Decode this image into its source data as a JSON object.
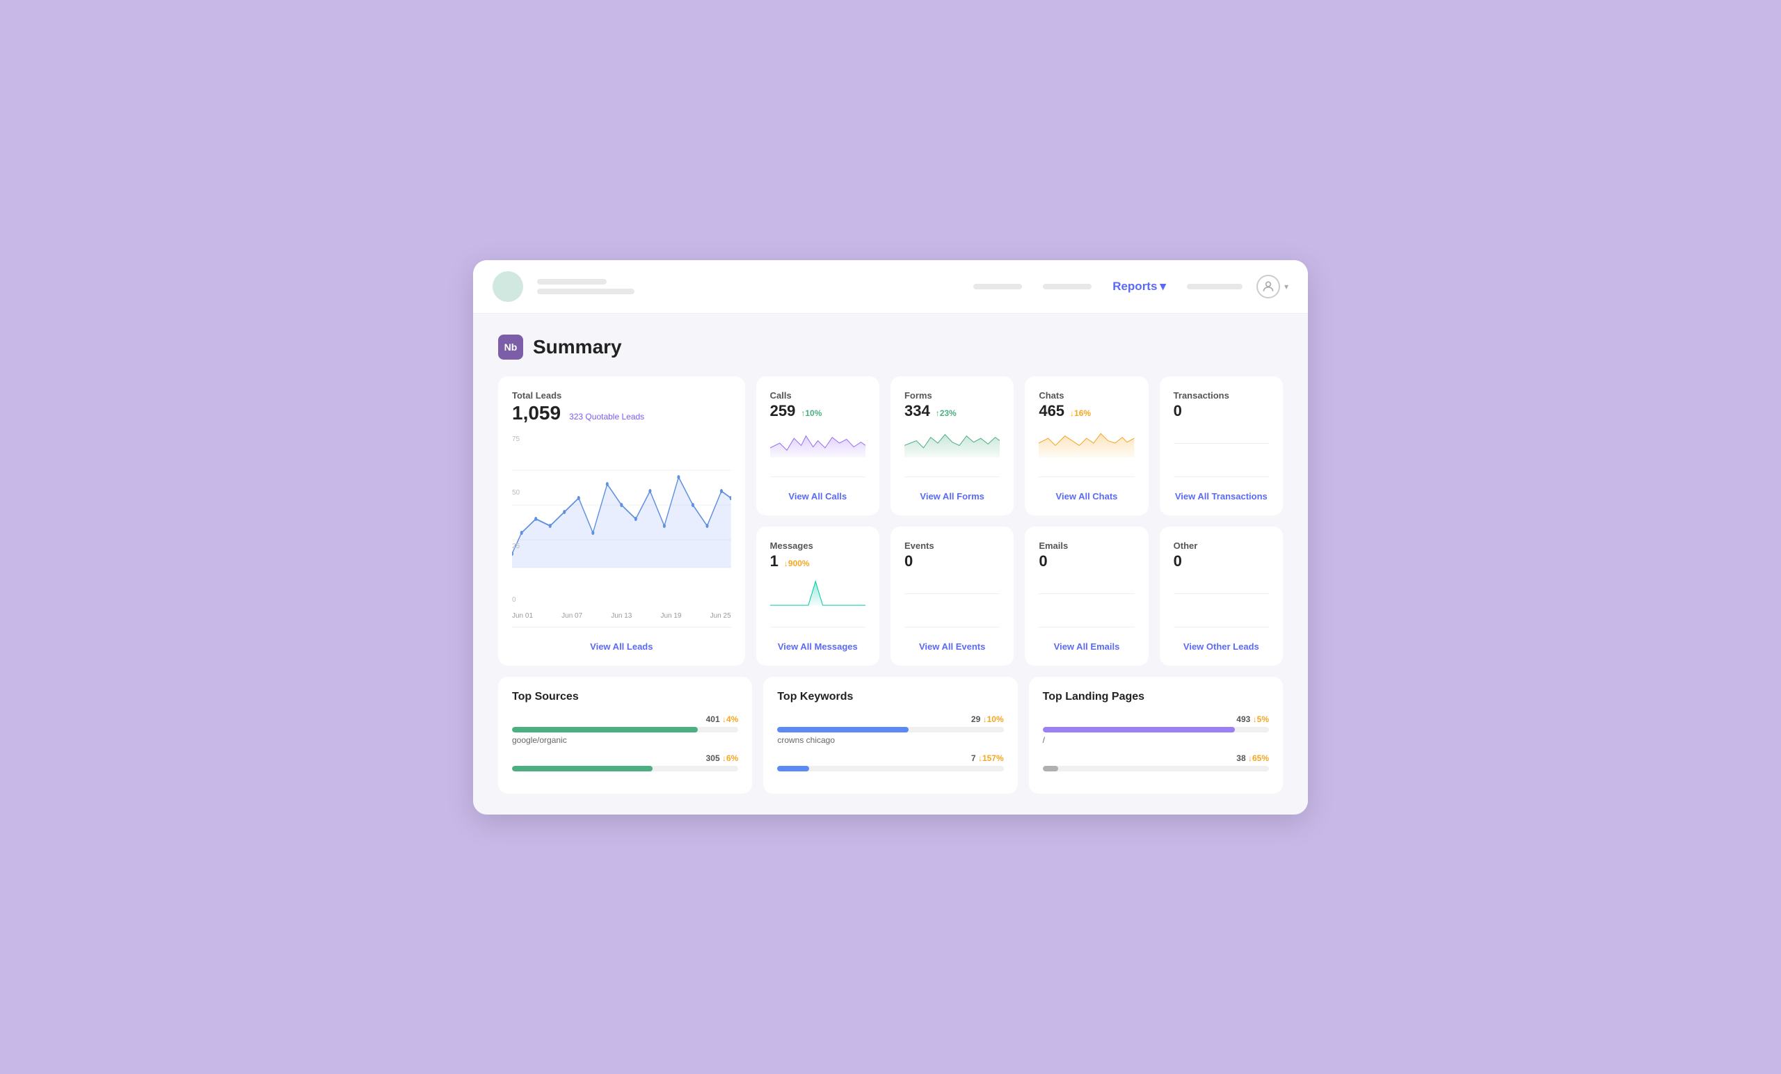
{
  "nav": {
    "reports_label": "Reports",
    "reports_dropdown": "▾",
    "placeholder1": "",
    "placeholder2": "",
    "placeholder3": ""
  },
  "page": {
    "icon_label": "Nb",
    "title": "Summary"
  },
  "cards": {
    "total_leads": {
      "label": "Total Leads",
      "value": "1,059",
      "quotable": "323 Quotable Leads",
      "view_link": "View All Leads",
      "y_labels": [
        "75",
        "50",
        "25",
        "0"
      ],
      "x_labels": [
        "Jun 01",
        "Jun 07",
        "Jun 13",
        "Jun 19",
        "Jun 25"
      ]
    },
    "calls": {
      "label": "Calls",
      "value": "259",
      "change": "↑10%",
      "change_type": "up",
      "view_link": "View All Calls"
    },
    "forms": {
      "label": "Forms",
      "value": "334",
      "change": "↑23%",
      "change_type": "up",
      "view_link": "View All Forms"
    },
    "chats": {
      "label": "Chats",
      "value": "465",
      "change": "↓16%",
      "change_type": "down",
      "view_link": "View All Chats"
    },
    "transactions": {
      "label": "Transactions",
      "value": "0",
      "view_link": "View All Transactions"
    },
    "messages": {
      "label": "Messages",
      "value": "1",
      "change": "↓900%",
      "change_type": "down",
      "view_link": "View All Messages"
    },
    "events": {
      "label": "Events",
      "value": "0",
      "view_link": "View All Events"
    },
    "emails": {
      "label": "Emails",
      "value": "0",
      "view_link": "View All Emails"
    },
    "other": {
      "label": "Other",
      "value": "0",
      "view_link": "View Other Leads"
    }
  },
  "top_sources": {
    "title": "Top Sources",
    "items": [
      {
        "name": "google/organic",
        "value": "401",
        "change": "↓4%",
        "change_type": "down",
        "pct": 82
      },
      {
        "name": "",
        "value": "305",
        "change": "↓6%",
        "change_type": "down",
        "pct": 62
      }
    ]
  },
  "top_keywords": {
    "title": "Top Keywords",
    "items": [
      {
        "name": "crowns chicago",
        "value": "29",
        "change": "↓10%",
        "change_type": "down",
        "pct": 58
      },
      {
        "name": "",
        "value": "7",
        "change": "↓157%",
        "change_type": "down",
        "pct": 14
      }
    ]
  },
  "top_landing_pages": {
    "title": "Top Landing Pages",
    "items": [
      {
        "name": "/",
        "value": "493",
        "change": "↓5%",
        "change_type": "down",
        "pct": 85
      },
      {
        "name": "",
        "value": "38",
        "change": "↓65%",
        "change_type": "down",
        "pct": 7
      }
    ]
  }
}
